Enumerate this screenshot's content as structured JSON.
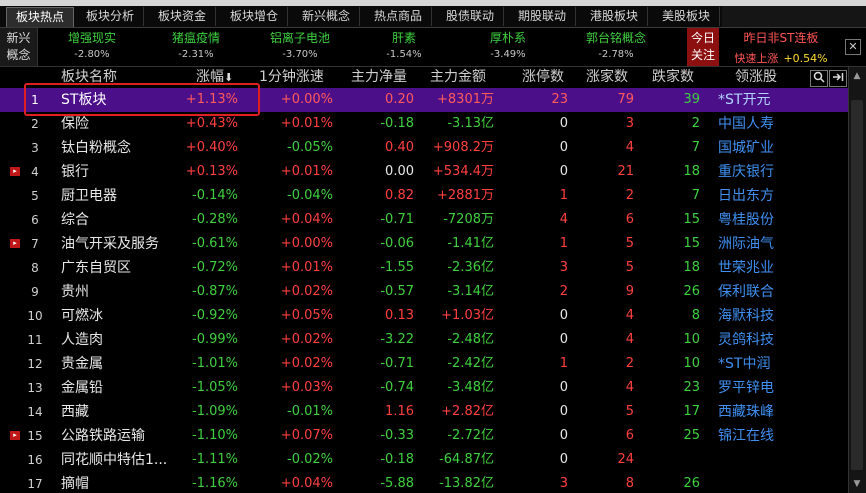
{
  "tabs": [
    {
      "label": "板块热点",
      "active": true
    },
    {
      "label": "板块分析"
    },
    {
      "label": "板块资金"
    },
    {
      "label": "板块增仓"
    },
    {
      "label": "新兴概念"
    },
    {
      "label": "热点商品"
    },
    {
      "label": "股债联动"
    },
    {
      "label": "期股联动"
    },
    {
      "label": "港股板块"
    },
    {
      "label": "美股板块"
    }
  ],
  "ticker": {
    "label_line1": "新兴",
    "label_line2": "概念",
    "items": [
      {
        "name": "增强现实",
        "pct": "-2.80%"
      },
      {
        "name": "猪瘟疫情",
        "pct": "-2.31%"
      },
      {
        "name": "铝离子电池",
        "pct": "-3.70%"
      },
      {
        "name": "肝素",
        "pct": "-1.54%"
      },
      {
        "name": "厚朴系",
        "pct": "-3.49%"
      },
      {
        "name": "郭台铭概念",
        "pct": "-2.78%"
      }
    ],
    "today_line1": "今日",
    "today_line2": "关注",
    "hot_title": "昨日非ST连板",
    "hot_sub": "快速上涨",
    "hot_pct": "+0.54%",
    "close_icon": "✕"
  },
  "columns": {
    "name": "板块名称",
    "change": "涨幅",
    "speed": "1分钟涨速",
    "net_inflow": "主力净量",
    "main_amount": "主力金额",
    "limit_up": "涨停数",
    "up_count": "涨家数",
    "down_count": "跌家数",
    "leader": "领涨股"
  },
  "sort_icon": "⬇",
  "rows": [
    {
      "num": "1",
      "name": "ST板块",
      "chg": "+1.13%",
      "spd": "+0.00%",
      "net": "0.20",
      "amt": "+8301万",
      "lu": "23",
      "up": "79",
      "dn": "39",
      "lead": "*ST开元",
      "sel": true
    },
    {
      "num": "2",
      "name": "保险",
      "chg": "+0.43%",
      "spd": "+0.01%",
      "net": "-0.18",
      "amt": "-3.13亿",
      "lu": "0",
      "up": "3",
      "dn": "2",
      "lead": "中国人寿"
    },
    {
      "num": "3",
      "name": "钛白粉概念",
      "chg": "+0.40%",
      "spd": "-0.05%",
      "net": "0.40",
      "amt": "+908.2万",
      "lu": "0",
      "up": "4",
      "dn": "7",
      "lead": "国城矿业"
    },
    {
      "num": "4",
      "name": "银行",
      "chg": "+0.13%",
      "spd": "+0.01%",
      "net": "0.00",
      "amt": "+534.4万",
      "lu": "0",
      "up": "21",
      "dn": "18",
      "lead": "重庆银行",
      "mark": true
    },
    {
      "num": "5",
      "name": "厨卫电器",
      "chg": "-0.14%",
      "spd": "-0.04%",
      "net": "0.82",
      "amt": "+2881万",
      "lu": "1",
      "up": "2",
      "dn": "7",
      "lead": "日出东方"
    },
    {
      "num": "6",
      "name": "综合",
      "chg": "-0.28%",
      "spd": "+0.04%",
      "net": "-0.71",
      "amt": "-7208万",
      "lu": "4",
      "up": "6",
      "dn": "15",
      "lead": "粤桂股份"
    },
    {
      "num": "7",
      "name": "油气开采及服务",
      "chg": "-0.61%",
      "spd": "+0.00%",
      "net": "-0.06",
      "amt": "-1.41亿",
      "lu": "1",
      "up": "5",
      "dn": "15",
      "lead": "洲际油气",
      "mark": true
    },
    {
      "num": "8",
      "name": "广东自贸区",
      "chg": "-0.72%",
      "spd": "+0.01%",
      "net": "-1.55",
      "amt": "-2.36亿",
      "lu": "3",
      "up": "5",
      "dn": "18",
      "lead": "世荣兆业"
    },
    {
      "num": "9",
      "name": "贵州",
      "chg": "-0.87%",
      "spd": "+0.02%",
      "net": "-0.57",
      "amt": "-3.14亿",
      "lu": "2",
      "up": "9",
      "dn": "26",
      "lead": "保利联合"
    },
    {
      "num": "10",
      "name": "可燃冰",
      "chg": "-0.92%",
      "spd": "+0.05%",
      "net": "0.13",
      "amt": "+1.03亿",
      "lu": "0",
      "up": "4",
      "dn": "8",
      "lead": "海默科技"
    },
    {
      "num": "11",
      "name": "人造肉",
      "chg": "-0.99%",
      "spd": "+0.02%",
      "net": "-3.22",
      "amt": "-2.48亿",
      "lu": "0",
      "up": "4",
      "dn": "10",
      "lead": "灵鸽科技"
    },
    {
      "num": "12",
      "name": "贵金属",
      "chg": "-1.01%",
      "spd": "+0.02%",
      "net": "-0.71",
      "amt": "-2.42亿",
      "lu": "1",
      "up": "2",
      "dn": "10",
      "lead": "*ST中润"
    },
    {
      "num": "13",
      "name": "金属铅",
      "chg": "-1.05%",
      "spd": "+0.03%",
      "net": "-0.74",
      "amt": "-3.48亿",
      "lu": "0",
      "up": "4",
      "dn": "23",
      "lead": "罗平锌电"
    },
    {
      "num": "14",
      "name": "西藏",
      "chg": "-1.09%",
      "spd": "-0.01%",
      "net": "1.16",
      "amt": "+2.82亿",
      "lu": "0",
      "up": "5",
      "dn": "17",
      "lead": "西藏珠峰"
    },
    {
      "num": "15",
      "name": "公路铁路运输",
      "chg": "-1.10%",
      "spd": "+0.07%",
      "net": "-0.33",
      "amt": "-2.72亿",
      "lu": "0",
      "up": "6",
      "dn": "25",
      "lead": "锦江在线",
      "mark": true
    },
    {
      "num": "16",
      "name": "同花顺中特估1...",
      "chg": "-1.11%",
      "spd": "-0.02%",
      "net": "-0.18",
      "amt": "-64.87亿",
      "lu": "0",
      "up": "24",
      "dn": "",
      "lead": ""
    },
    {
      "num": "17",
      "name": "摘帽",
      "chg": "-1.16%",
      "spd": "+0.04%",
      "net": "-5.88",
      "amt": "-13.82亿",
      "lu": "3",
      "up": "8",
      "dn": "26",
      "lead": ""
    }
  ]
}
